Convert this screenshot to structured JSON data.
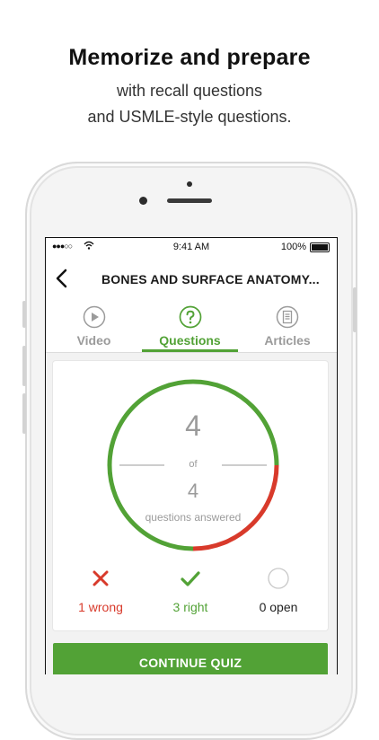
{
  "promo": {
    "headline": "Memorize and prepare",
    "subline_1": "with recall questions",
    "subline_2": "and USMLE-style questions."
  },
  "status_bar": {
    "time": "9:41 AM",
    "battery": "100%",
    "signal_icon": "signal-dots-icon",
    "wifi_icon": "wifi-icon"
  },
  "nav": {
    "title": "BONES AND SURFACE ANATOMY...",
    "back_icon": "chevron-left-icon"
  },
  "tabs": [
    {
      "label": "Video",
      "icon": "play-circle-icon",
      "active": false
    },
    {
      "label": "Questions",
      "icon": "question-circle-icon",
      "active": true
    },
    {
      "label": "Articles",
      "icon": "document-icon",
      "active": false
    }
  ],
  "progress": {
    "answered": "4",
    "of_label": "of",
    "total": "4",
    "caption": "questions answered",
    "wrong_count": 1,
    "right_count": 3,
    "open_count": 0
  },
  "stats": {
    "wrong_label": "1 wrong",
    "right_label": "3 right",
    "open_label": "0 open"
  },
  "cta": {
    "label": "CONTINUE QUIZ"
  },
  "colors": {
    "accent_green": "#52a236",
    "error_red": "#d83a2b",
    "muted_gray": "#9b9b9b"
  }
}
